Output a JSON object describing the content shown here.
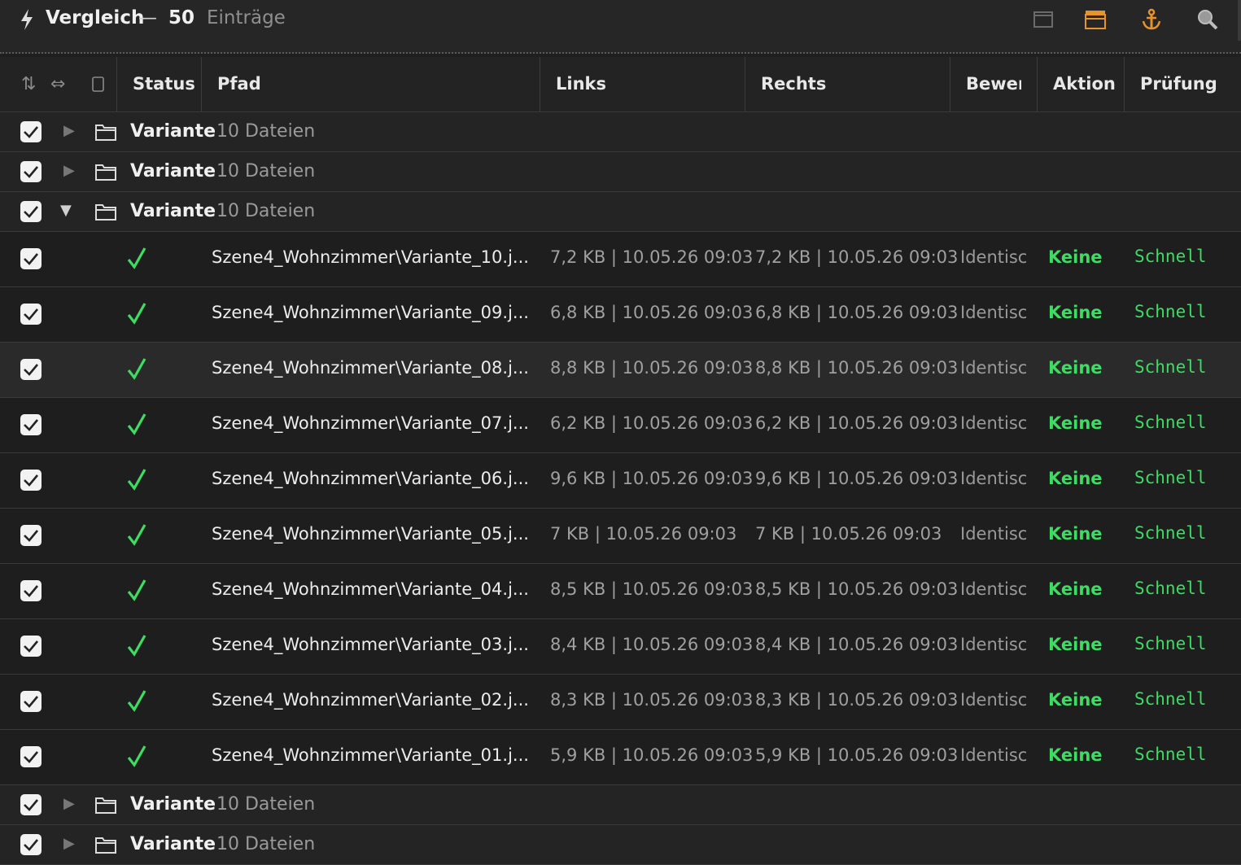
{
  "titlebar": {
    "title": "Vergleich",
    "dash": "—",
    "count": "50",
    "count_label": "Einträge",
    "icons": [
      "window-icon",
      "clapperboard-icon",
      "anchor-icon",
      "search-icon"
    ],
    "accent": "#e8922a"
  },
  "header": {
    "columns": [
      "Status",
      "Pfad",
      "Links",
      "Rechts",
      "Bewert",
      "Aktion",
      "Prüfung"
    ],
    "icons": [
      "sort-icon",
      "swap-icon",
      "copy-icon"
    ]
  },
  "groups": [
    {
      "name": "Variante",
      "count": "10 Dateien",
      "expanded": false
    },
    {
      "name": "Variante",
      "count": "10 Dateien",
      "expanded": false
    },
    {
      "name": "Variante",
      "count": "10 Dateien",
      "expanded": true
    },
    {
      "name": "Variante",
      "count": "10 Dateien",
      "expanded": false
    },
    {
      "name": "Variante",
      "count": "10 Dateien",
      "expanded": false
    }
  ],
  "files": [
    {
      "path": "Szene4_Wohnzimmer\\Variante_10.j...",
      "links": "7,2 KB | 10.05.26 09:03",
      "rechts": "7,2 KB | 10.05.26 09:03",
      "bewert": "Identisch",
      "aktion": "Keine",
      "pruefung": "Schnell"
    },
    {
      "path": "Szene4_Wohnzimmer\\Variante_09.j...",
      "links": "6,8 KB | 10.05.26 09:03",
      "rechts": "6,8 KB | 10.05.26 09:03",
      "bewert": "Identisch",
      "aktion": "Keine",
      "pruefung": "Schnell"
    },
    {
      "path": "Szene4_Wohnzimmer\\Variante_08.j...",
      "links": "8,8 KB | 10.05.26 09:03",
      "rechts": "8,8 KB | 10.05.26 09:03",
      "bewert": "Identisch",
      "aktion": "Keine",
      "pruefung": "Schnell"
    },
    {
      "path": "Szene4_Wohnzimmer\\Variante_07.j...",
      "links": "6,2 KB | 10.05.26 09:03",
      "rechts": "6,2 KB | 10.05.26 09:03",
      "bewert": "Identisch",
      "aktion": "Keine",
      "pruefung": "Schnell"
    },
    {
      "path": "Szene4_Wohnzimmer\\Variante_06.j...",
      "links": "9,6 KB | 10.05.26 09:03",
      "rechts": "9,6 KB | 10.05.26 09:03",
      "bewert": "Identisch",
      "aktion": "Keine",
      "pruefung": "Schnell"
    },
    {
      "path": "Szene4_Wohnzimmer\\Variante_05.j...",
      "links": "7 KB | 10.05.26 09:03",
      "rechts": "7 KB | 10.05.26 09:03",
      "bewert": "Identisch",
      "aktion": "Keine",
      "pruefung": "Schnell"
    },
    {
      "path": "Szene4_Wohnzimmer\\Variante_04.j...",
      "links": "8,5 KB | 10.05.26 09:03",
      "rechts": "8,5 KB | 10.05.26 09:03",
      "bewert": "Identisch",
      "aktion": "Keine",
      "pruefung": "Schnell"
    },
    {
      "path": "Szene4_Wohnzimmer\\Variante_03.j...",
      "links": "8,4 KB | 10.05.26 09:03",
      "rechts": "8,4 KB | 10.05.26 09:03",
      "bewert": "Identisch",
      "aktion": "Keine",
      "pruefung": "Schnell"
    },
    {
      "path": "Szene4_Wohnzimmer\\Variante_02.j...",
      "links": "8,3 KB | 10.05.26 09:03",
      "rechts": "8,3 KB | 10.05.26 09:03",
      "bewert": "Identisch",
      "aktion": "Keine",
      "pruefung": "Schnell"
    },
    {
      "path": "Szene4_Wohnzimmer\\Variante_01.j...",
      "links": "5,9 KB | 10.05.26 09:03",
      "rechts": "5,9 KB | 10.05.26 09:03",
      "bewert": "Identisch",
      "aktion": "Keine",
      "pruefung": "Schnell"
    }
  ],
  "colors": {
    "ok": "#3ddc63",
    "muted": "#9a9a9a"
  }
}
